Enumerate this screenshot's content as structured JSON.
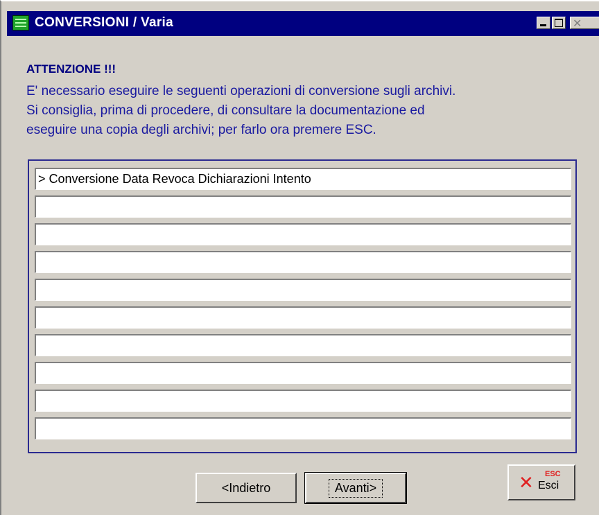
{
  "window": {
    "title": "CONVERSIONI / Varia"
  },
  "warning": {
    "heading": "ATTENZIONE !!!",
    "lines": [
      "E' necessario eseguire le seguenti operazioni di conversione sugli archivi.",
      "Si consiglia, prima di procedere, di  consultare la documentazione ed",
      "eseguire una copia degli archivi; per farlo ora premere ESC."
    ]
  },
  "list": {
    "rows": [
      "> Conversione Data Revoca Dichiarazioni Intento",
      "",
      "",
      "",
      "",
      "",
      "",
      "",
      "",
      ""
    ]
  },
  "buttons": {
    "back_label": "<Indietro",
    "next_label": "Avanti>",
    "exit_label": "Esci",
    "exit_shortcut": "ESC"
  },
  "icons": {
    "app": "application-icon",
    "minimize": "minimize-icon",
    "maximize": "maximize-icon",
    "close": "close-icon",
    "exit": "red-x-icon"
  },
  "colors": {
    "titlebar": "#000080",
    "window_bg": "#d4d0c8",
    "warning_text": "#1a1aa0",
    "exit_icon": "#e02020"
  }
}
